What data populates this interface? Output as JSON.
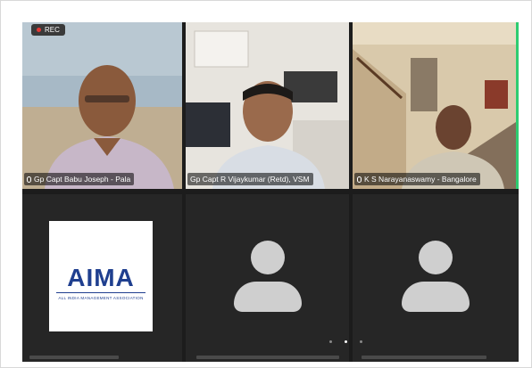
{
  "recording": {
    "label": "REC",
    "color": "#e53935"
  },
  "participants": [
    {
      "name": "Gp Capt Babu Joseph - Pala",
      "video": true,
      "colors": {
        "wall": "#a7b9c6",
        "skin": "#8a5a3c",
        "shirt": "#c7b7c8"
      }
    },
    {
      "name": "Gp Capt R Vijaykumar (Retd), VSM",
      "video": true,
      "colors": {
        "wall": "#e7e4de",
        "skin": "#9a6a4c",
        "shirt": "#d8dde4"
      }
    },
    {
      "name": "K S Narayanaswamy - Bangalore",
      "video": true,
      "active_speaker": true,
      "colors": {
        "wall": "#d9c9ab",
        "skin": "#6a4330",
        "shirt": "#cfc7b5"
      }
    },
    {
      "avatar_logo": {
        "text": "AIMA",
        "subtitle": "ALL INDIA MANAGEMENT ASSOCIATION",
        "color": "#1f3f8f"
      },
      "video": false
    },
    {
      "video": false,
      "avatar_icon": "person-placeholder-icon"
    },
    {
      "video": false,
      "avatar_icon": "person-placeholder-icon"
    }
  ],
  "pagination": {
    "pages": 3,
    "current": 2
  },
  "theme": {
    "background": "#1c1c1c",
    "active_speaker_border": "#2ecc71",
    "placeholder_color": "#cfcfcf"
  }
}
